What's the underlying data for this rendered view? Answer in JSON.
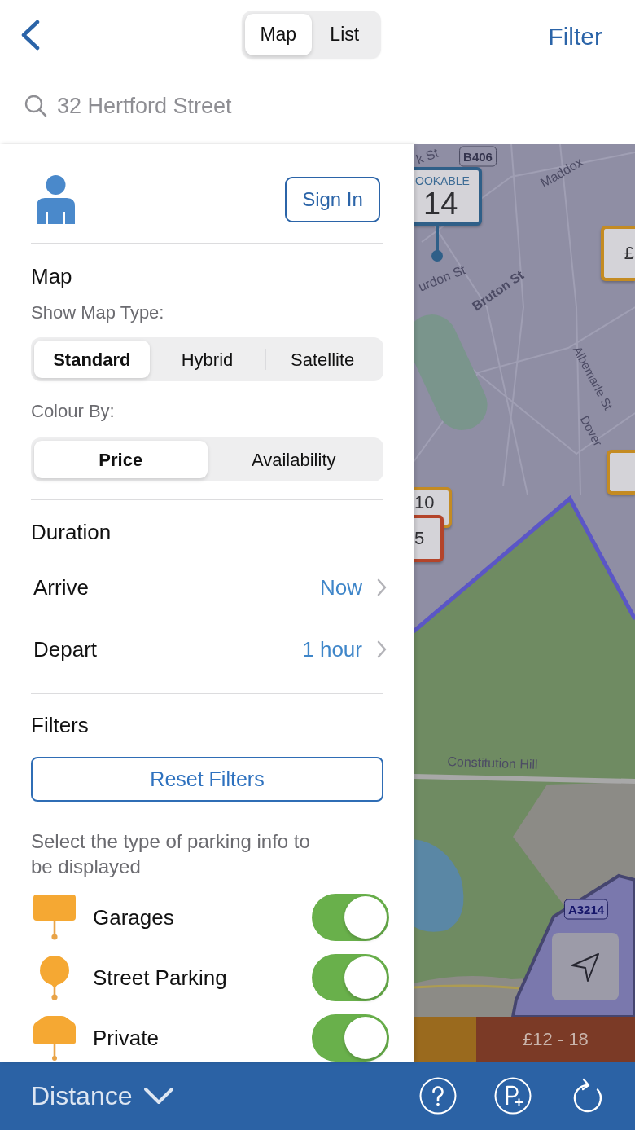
{
  "header": {
    "view_tabs": [
      {
        "label": "Map",
        "selected": true
      },
      {
        "label": "List",
        "selected": false
      }
    ],
    "filter_label": "Filter"
  },
  "search": {
    "placeholder": "32 Hertford Street"
  },
  "drawer": {
    "sign_in_label": "Sign In",
    "map": {
      "title": "Map",
      "map_type_label": "Show Map Type:",
      "map_types": [
        {
          "label": "Standard",
          "selected": true
        },
        {
          "label": "Hybrid",
          "selected": false
        },
        {
          "label": "Satellite",
          "selected": false
        }
      ],
      "colour_by_label": "Colour By:",
      "colour_by": [
        {
          "label": "Price",
          "selected": true
        },
        {
          "label": "Availability",
          "selected": false
        }
      ]
    },
    "duration": {
      "title": "Duration",
      "rows": [
        {
          "label": "Arrive",
          "value": "Now"
        },
        {
          "label": "Depart",
          "value": "1 hour"
        }
      ]
    },
    "filters": {
      "title": "Filters",
      "reset_label": "Reset Filters",
      "hint": "Select the type of parking info to be displayed",
      "parking_types": [
        {
          "kind": "garage",
          "label": "Garages",
          "on": true
        },
        {
          "kind": "street",
          "label": "Street Parking",
          "on": true
        },
        {
          "kind": "private",
          "label": "Private",
          "on": true
        }
      ]
    }
  },
  "map": {
    "labels": [
      {
        "kind": "street",
        "text": "k St"
      },
      {
        "kind": "road-sign",
        "text": "B406"
      },
      {
        "kind": "street",
        "text": "Maddox"
      },
      {
        "kind": "street",
        "text": "urdon St"
      },
      {
        "kind": "street",
        "text": "Bruton St"
      },
      {
        "kind": "street",
        "text": "Albemarle St"
      },
      {
        "kind": "street",
        "text": "Dover"
      },
      {
        "kind": "street",
        "text": "Constitution Hill"
      },
      {
        "kind": "road-sign",
        "text": "A3214"
      }
    ],
    "pins": [
      {
        "kind": "bookable",
        "tag": "OOKABLE",
        "price": "14",
        "color": "#2f5f88"
      },
      {
        "kind": "price",
        "price": "£",
        "color": "#c48b22"
      },
      {
        "kind": "price",
        "color": "#c48b22"
      },
      {
        "kind": "price",
        "price": "10",
        "color": "#c48b22"
      },
      {
        "kind": "price",
        "price": "5",
        "color": "#b4442a"
      }
    ],
    "price_bands": [
      {
        "color": "#9a6a1e"
      },
      {
        "label": "£12 - 18",
        "color": "#7b3a26"
      }
    ]
  },
  "bottom_bar": {
    "sort_label": "Distance"
  }
}
